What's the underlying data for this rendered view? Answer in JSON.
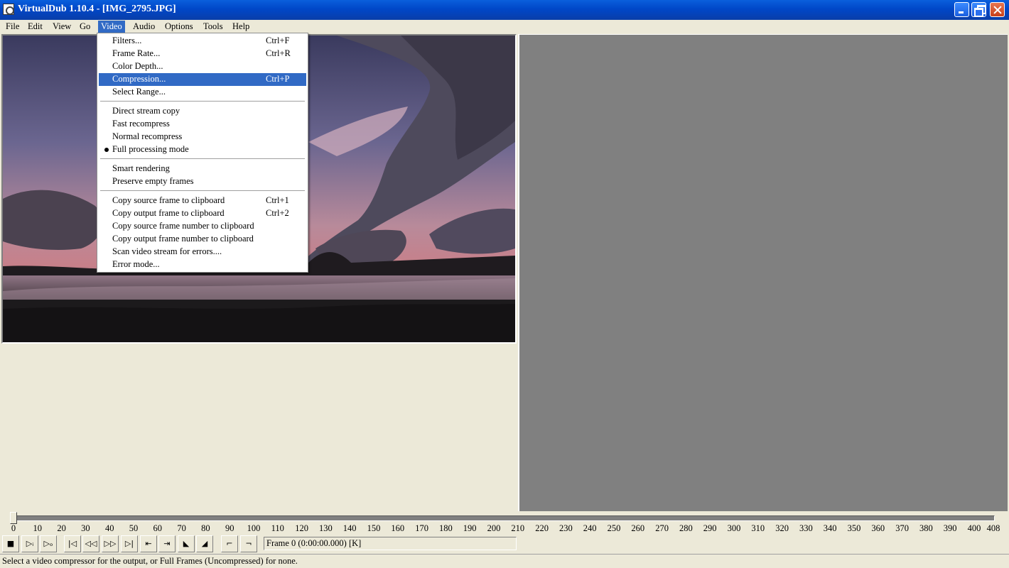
{
  "window": {
    "title": "VirtualDub 1.10.4 - [IMG_2795.JPG]"
  },
  "menubar": [
    {
      "label": "File",
      "active": false
    },
    {
      "label": "Edit",
      "active": false
    },
    {
      "label": "View",
      "active": false
    },
    {
      "label": "Go",
      "active": false
    },
    {
      "label": "Video",
      "active": true
    },
    {
      "label": "Audio",
      "active": false
    },
    {
      "label": "Options",
      "active": false
    },
    {
      "label": "Tools",
      "active": false
    },
    {
      "label": "Help",
      "active": false
    }
  ],
  "video_menu": {
    "items": [
      {
        "label": "Filters...",
        "shortcut": "Ctrl+F"
      },
      {
        "label": "Frame Rate...",
        "shortcut": "Ctrl+R"
      },
      {
        "label": "Color Depth...",
        "shortcut": ""
      },
      {
        "label": "Compression...",
        "shortcut": "Ctrl+P",
        "highlighted": true
      },
      {
        "label": "Select Range...",
        "shortcut": ""
      },
      {
        "label": "Direct stream copy",
        "shortcut": ""
      },
      {
        "label": "Fast recompress",
        "shortcut": ""
      },
      {
        "label": "Normal recompress",
        "shortcut": ""
      },
      {
        "label": "Full processing mode",
        "shortcut": "",
        "checked": true
      },
      {
        "label": "Smart rendering",
        "shortcut": ""
      },
      {
        "label": "Preserve empty frames",
        "shortcut": ""
      },
      {
        "label": "Copy source frame to clipboard",
        "shortcut": "Ctrl+1"
      },
      {
        "label": "Copy output frame to clipboard",
        "shortcut": "Ctrl+2"
      },
      {
        "label": "Copy source frame number to clipboard",
        "shortcut": ""
      },
      {
        "label": "Copy output frame number to clipboard",
        "shortcut": ""
      },
      {
        "label": "Scan video stream for errors....",
        "shortcut": ""
      },
      {
        "label": "Error mode...",
        "shortcut": ""
      }
    ]
  },
  "timeline": {
    "position": 0,
    "max": 408,
    "tick_labels": [
      "0",
      "10",
      "20",
      "30",
      "40",
      "50",
      "60",
      "70",
      "80",
      "90",
      "100",
      "110",
      "120",
      "130",
      "140",
      "150",
      "160",
      "170",
      "180",
      "190",
      "200",
      "210",
      "220",
      "230",
      "240",
      "250",
      "260",
      "270",
      "280",
      "290",
      "300",
      "310",
      "320",
      "330",
      "340",
      "350",
      "360",
      "370",
      "380",
      "390",
      "400",
      "408"
    ]
  },
  "toolbar": {
    "buttons": [
      {
        "name": "stop",
        "icon": "stop-icon",
        "glyph": "■"
      },
      {
        "name": "play-input",
        "icon": "play-input-icon",
        "glyph": "▷ᵢ"
      },
      {
        "name": "play-output",
        "icon": "play-output-icon",
        "glyph": "▷ₒ"
      },
      {
        "name": "go-start",
        "icon": "go-start-icon",
        "glyph": "|◁"
      },
      {
        "name": "prev-key",
        "icon": "rewind-icon",
        "glyph": "◁◁"
      },
      {
        "name": "next-key",
        "icon": "fast-forward-icon",
        "glyph": "▷▷"
      },
      {
        "name": "go-end",
        "icon": "go-end-icon",
        "glyph": "▷|"
      },
      {
        "name": "prev-scene",
        "icon": "prev-scene-icon",
        "glyph": "⇤"
      },
      {
        "name": "next-scene",
        "icon": "next-scene-icon",
        "glyph": "⇥"
      },
      {
        "name": "mark-in",
        "icon": "mark-in-icon",
        "glyph": "◣"
      },
      {
        "name": "mark-out",
        "icon": "mark-out-icon",
        "glyph": "◢"
      },
      {
        "name": "set-start",
        "icon": "set-start-icon",
        "glyph": "⌐"
      },
      {
        "name": "set-end",
        "icon": "set-end-icon",
        "glyph": "¬"
      }
    ],
    "frame_text": "Frame 0 (0:00:00.000) [K]"
  },
  "status": {
    "text": "Select a video compressor for the output, or Full Frames (Uncompressed) for none."
  },
  "colors": {
    "titlebar": "#0a5fdc",
    "highlight": "#316ac5",
    "workspace": "#ece9d8",
    "output_bg": "#808080"
  }
}
